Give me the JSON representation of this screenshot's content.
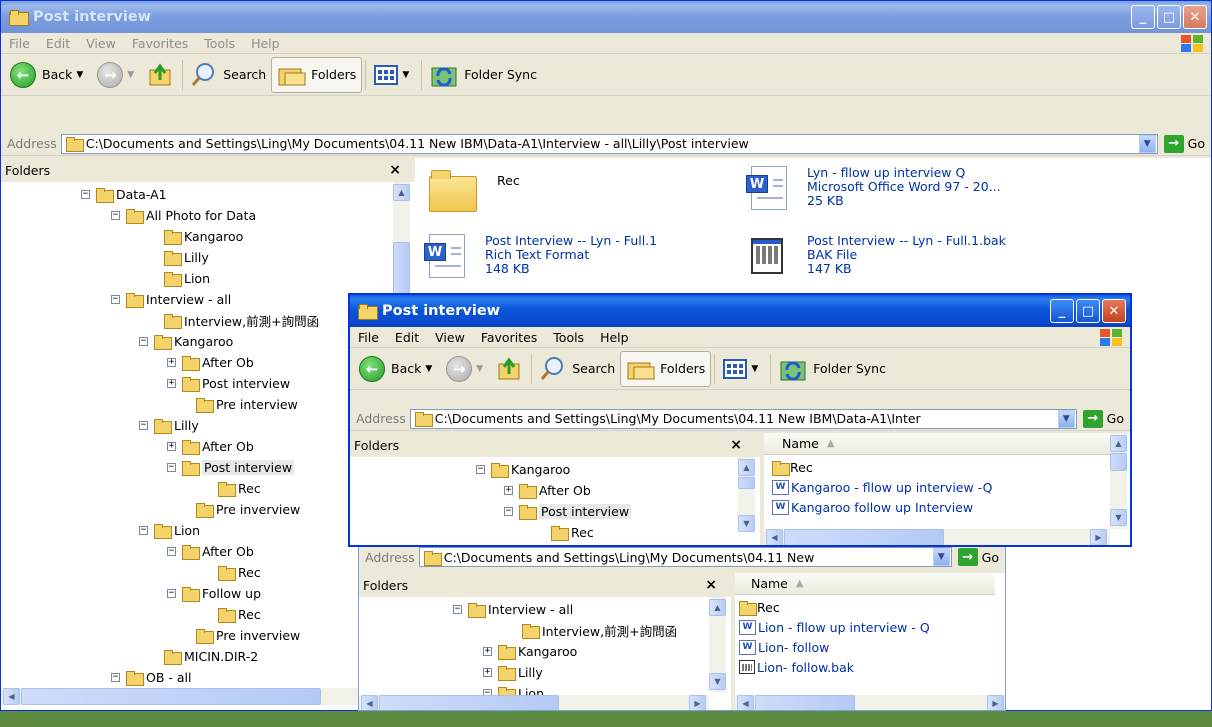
{
  "back_window": {
    "title": "Post interview",
    "menu": [
      "File",
      "Edit",
      "View",
      "Favorites",
      "Tools",
      "Help"
    ],
    "toolbar": {
      "back": "Back",
      "search": "Search",
      "folders": "Folders",
      "sync": "Folder Sync"
    },
    "address_label": "Address",
    "address": "C:\\Documents and Settings\\Ling\\My Documents\\04.11 New IBM\\Data-A1\\Interview - all\\Lilly\\Post interview",
    "go": "Go",
    "folders_label": "Folders",
    "close_x": "×",
    "tree": [
      {
        "label": "Data-A1",
        "pm": "⊟"
      },
      {
        "label": "All Photo for Data",
        "pm": "⊟"
      },
      {
        "label": "Kangaroo",
        "pm": ""
      },
      {
        "label": "Lilly",
        "pm": ""
      },
      {
        "label": "Lion",
        "pm": ""
      },
      {
        "label": "Interview - all",
        "pm": "⊟"
      },
      {
        "label": "Interview,前測+詢問函",
        "pm": ""
      },
      {
        "label": "Kangaroo",
        "pm": "⊟"
      },
      {
        "label": "After Ob",
        "pm": "⊞"
      },
      {
        "label": "Post interview",
        "pm": "⊞"
      },
      {
        "label": "Pre interview",
        "pm": ""
      },
      {
        "label": "Lilly",
        "pm": "⊟"
      },
      {
        "label": "After Ob",
        "pm": "⊞"
      },
      {
        "label": "Post interview",
        "pm": "⊟"
      },
      {
        "label": "Rec",
        "pm": ""
      },
      {
        "label": "Pre inverview",
        "pm": ""
      },
      {
        "label": "Lion",
        "pm": "⊟"
      },
      {
        "label": "After Ob",
        "pm": "⊟"
      },
      {
        "label": "Rec",
        "pm": ""
      },
      {
        "label": "Follow up",
        "pm": "⊟"
      },
      {
        "label": "Rec",
        "pm": ""
      },
      {
        "label": "Pre inverview",
        "pm": ""
      },
      {
        "label": "MICIN.DIR-2",
        "pm": ""
      },
      {
        "label": "OB - all",
        "pm": "⊟"
      }
    ],
    "files": [
      {
        "name": "Rec",
        "type": "",
        "size": ""
      },
      {
        "name": "Lyn - fllow up interview Q",
        "type": "Microsoft Office Word 97 - 20...",
        "size": "25 KB"
      },
      {
        "name": "Post Interview -- Lyn - Full.1",
        "type": "Rich Text Format",
        "size": "148 KB"
      },
      {
        "name": "Post Interview -- Lyn - Full.1.bak",
        "type": "BAK File",
        "size": "147 KB"
      }
    ]
  },
  "mid_window": {
    "address_label": "Address",
    "address": "C:\\Documents and Settings\\Ling\\My Documents\\04.11 New",
    "go": "Go",
    "folders_label": "Folders",
    "close_x": "×",
    "name_col": "Name",
    "tree": [
      {
        "label": "Interview - all",
        "pm": "⊟"
      },
      {
        "label": "Interview,前測+詢問函",
        "pm": ""
      },
      {
        "label": "Kangaroo",
        "pm": "⊞"
      },
      {
        "label": "Lilly",
        "pm": "⊞"
      },
      {
        "label": "Lion",
        "pm": "⊟"
      }
    ],
    "files": [
      "Rec",
      "Lion - fllow up interview - Q",
      "Lion- follow",
      "Lion- follow.bak"
    ]
  },
  "front_window": {
    "title": "Post interview",
    "menu": [
      "File",
      "Edit",
      "View",
      "Favorites",
      "Tools",
      "Help"
    ],
    "toolbar": {
      "back": "Back",
      "search": "Search",
      "folders": "Folders",
      "sync": "Folder Sync"
    },
    "address_label": "Address",
    "address": "C:\\Documents and Settings\\Ling\\My Documents\\04.11 New IBM\\Data-A1\\Inter",
    "go": "Go",
    "folders_label": "Folders",
    "close_x": "×",
    "name_col": "Name",
    "tree": [
      {
        "label": "Kangaroo",
        "pm": "⊟"
      },
      {
        "label": "After Ob",
        "pm": "⊞"
      },
      {
        "label": "Post interview",
        "pm": "⊟"
      },
      {
        "label": "Rec",
        "pm": ""
      }
    ],
    "files": [
      "Rec",
      "Kangaroo - fllow up interview -Q",
      "Kangaroo follow up Interview"
    ]
  }
}
